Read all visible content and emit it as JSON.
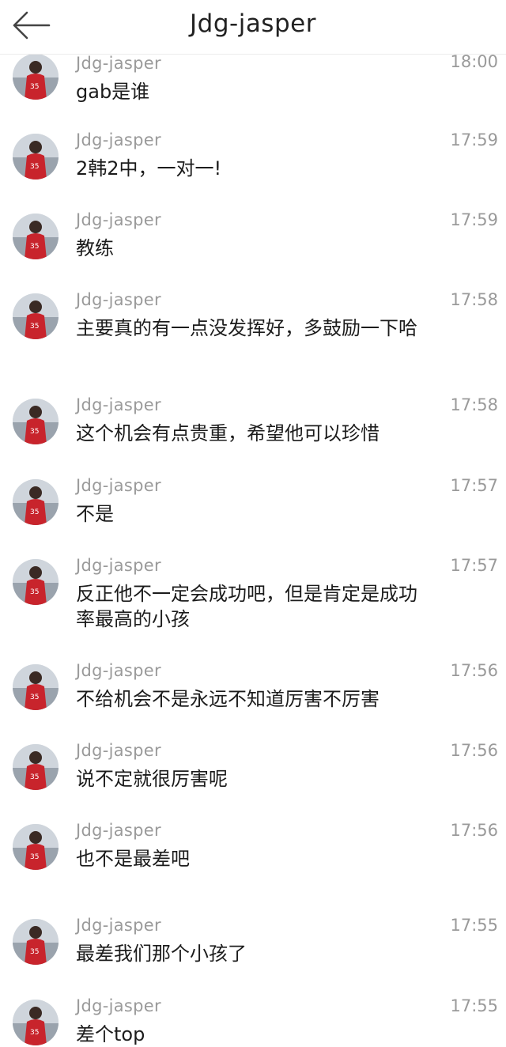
{
  "header": {
    "title": "Jdg-jasper"
  },
  "messages": [
    {
      "sender": "Jdg-jasper",
      "time": "18:00",
      "text": "gab是谁"
    },
    {
      "sender": "Jdg-jasper",
      "time": "17:59",
      "text": "2韩2中，一对一!"
    },
    {
      "sender": "Jdg-jasper",
      "time": "17:59",
      "text": "教练"
    },
    {
      "sender": "Jdg-jasper",
      "time": "17:58",
      "text": "主要真的有一点没发挥好，多鼓励一下哈"
    },
    {
      "sender": "Jdg-jasper",
      "time": "17:58",
      "text": "这个机会有点贵重，希望他可以珍惜"
    },
    {
      "sender": "Jdg-jasper",
      "time": "17:57",
      "text": "不是"
    },
    {
      "sender": "Jdg-jasper",
      "time": "17:57",
      "text": "反正他不一定会成功吧，但是肯定是成功率最高的小孩"
    },
    {
      "sender": "Jdg-jasper",
      "time": "17:56",
      "text": "不给机会不是永远不知道厉害不厉害"
    },
    {
      "sender": "Jdg-jasper",
      "time": "17:56",
      "text": "说不定就很厉害呢"
    },
    {
      "sender": "Jdg-jasper",
      "time": "17:56",
      "text": "也不是最差吧"
    },
    {
      "sender": "Jdg-jasper",
      "time": "17:55",
      "text": "最差我们那个小孩了"
    },
    {
      "sender": "Jdg-jasper",
      "time": "17:55",
      "text": "差个top"
    }
  ]
}
